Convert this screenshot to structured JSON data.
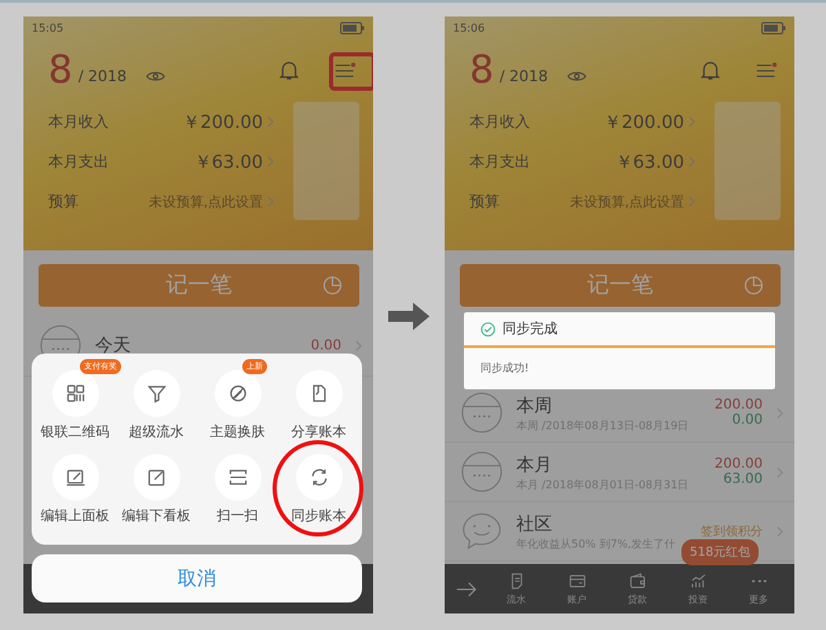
{
  "screens": [
    {
      "status_time": "15:05",
      "month": "8",
      "year": "/ 2018",
      "menu_annotated": true,
      "summary": [
        {
          "label": "本月收入",
          "value": "￥200.00",
          "kind": "amount"
        },
        {
          "label": "本月支出",
          "value": "￥63.00",
          "kind": "amount"
        },
        {
          "label": "预算",
          "value": "未设预算,点此设置",
          "kind": "hint"
        }
      ],
      "record_button": "记一笔",
      "rows": [
        {
          "title": "今天",
          "kind": "period",
          "income": "0.00"
        }
      ],
      "sheet": {
        "items": [
          {
            "label": "银联二维码",
            "badge": "支付有奖",
            "circled": false
          },
          {
            "label": "超级流水",
            "circled": false
          },
          {
            "label": "主题换肤",
            "badge": "上新",
            "circled": false
          },
          {
            "label": "分享账本",
            "circled": false
          },
          {
            "label": "编辑上面板",
            "circled": false
          },
          {
            "label": "编辑下看板",
            "circled": false
          },
          {
            "label": "扫一扫",
            "circled": false
          },
          {
            "label": "同步账本",
            "circled": true
          }
        ],
        "cancel": "取消"
      }
    },
    {
      "status_time": "15:06",
      "month": "8",
      "year": "/ 2018",
      "menu_annotated": false,
      "summary": [
        {
          "label": "本月收入",
          "value": "￥200.00",
          "kind": "amount"
        },
        {
          "label": "本月支出",
          "value": "￥63.00",
          "kind": "amount"
        },
        {
          "label": "预算",
          "value": "未设预算,点此设置",
          "kind": "hint"
        }
      ],
      "record_button": "记一笔",
      "toast": {
        "title": "同步完成",
        "message": "同步成功!"
      },
      "rows": [
        {
          "title": "本周",
          "kind": "period",
          "subtitle": "本周 /2018年08月13日-08月19日",
          "income": "200.00",
          "expense": "0.00"
        },
        {
          "title": "本月",
          "kind": "period",
          "subtitle": "本月 /2018年08月01日-08月31日",
          "income": "200.00",
          "expense": "63.00"
        },
        {
          "title": "社区",
          "kind": "community",
          "subtitle": "年化收益从50% 到7%,发生了什",
          "note": "签到领积分"
        }
      ],
      "promo": "518元红包",
      "nav": [
        {
          "label": "流水"
        },
        {
          "label": "账户"
        },
        {
          "label": "贷款"
        },
        {
          "label": "投资"
        },
        {
          "label": "更多"
        }
      ]
    }
  ]
}
